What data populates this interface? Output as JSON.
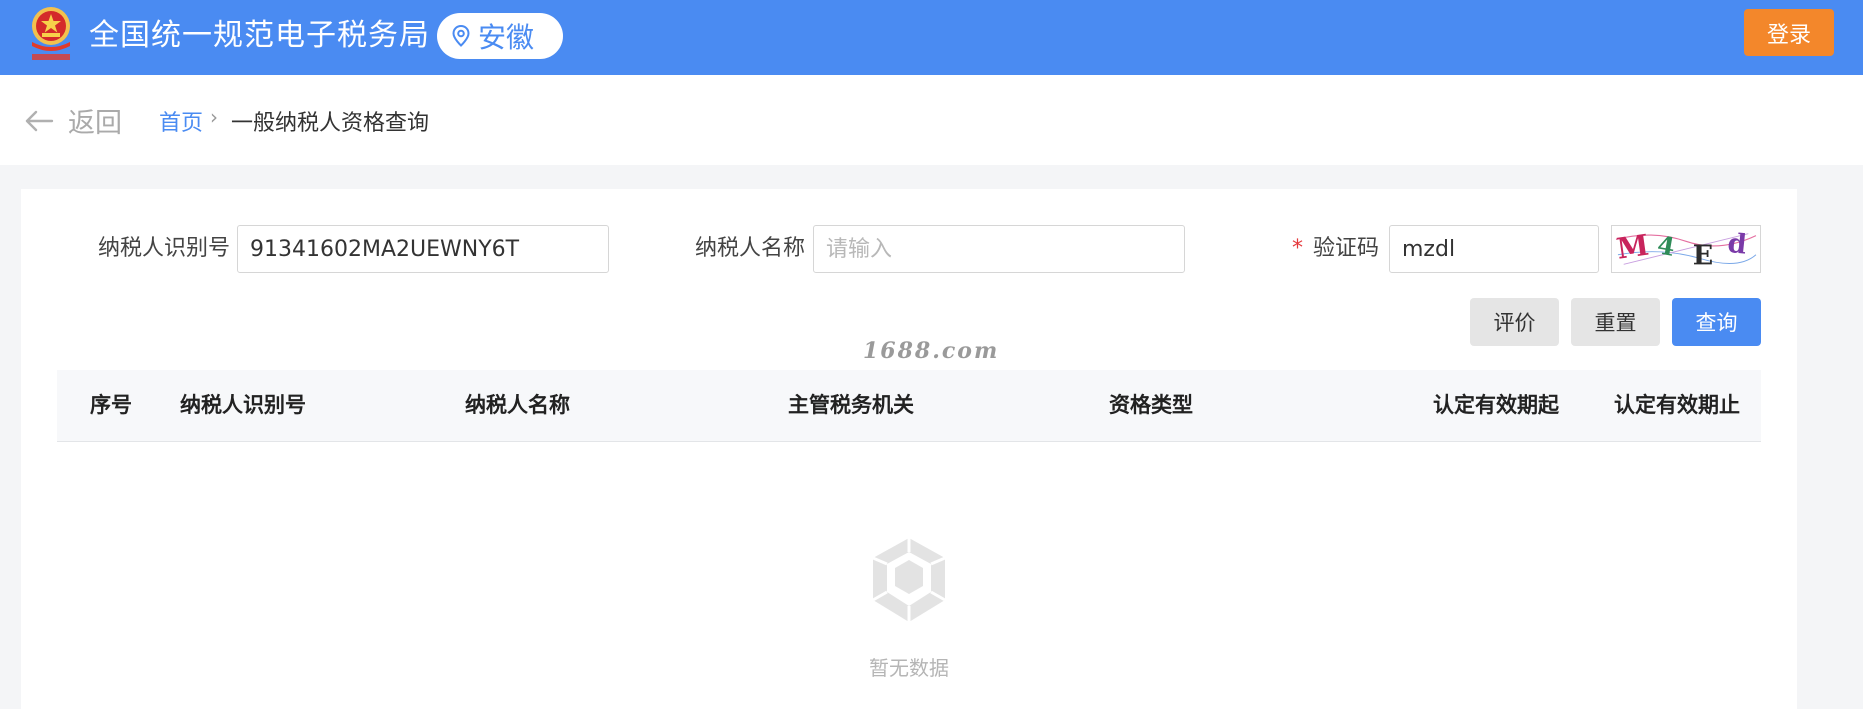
{
  "header": {
    "emblem_icon": "national-emblem-icon",
    "site_title": "全国统一规范电子税务局",
    "region": "安徽",
    "region_icon": "location-pin-icon",
    "login_label": "登录",
    "brand_color": "#4a8bf2",
    "login_color": "#f3872b"
  },
  "breadcrumb": {
    "back_label": "返回",
    "back_icon": "arrow-left-icon",
    "home": "首页",
    "separator": "›",
    "current": "一般纳税人资格查询"
  },
  "form": {
    "taxpayer_id_label": "纳税人识别号",
    "taxpayer_id_value": "91341602MA2UEWNY6T",
    "taxpayer_name_label": "纳税人名称",
    "taxpayer_name_placeholder": "请输入",
    "captcha_label": "验证码",
    "captcha_required_mark": "*",
    "captcha_value": "mzdl",
    "captcha_image_text": "M4Ed"
  },
  "actions": {
    "evaluate_label": "评价",
    "reset_label": "重置",
    "query_label": "查询"
  },
  "watermark": "1688.com",
  "table": {
    "columns": [
      "序号",
      "纳税人识别号",
      "纳税人名称",
      "主管税务机关",
      "资格类型",
      "认定有效期起",
      "认定有效期止"
    ],
    "empty_icon": "empty-box-icon",
    "empty_text": "暂无数据"
  }
}
